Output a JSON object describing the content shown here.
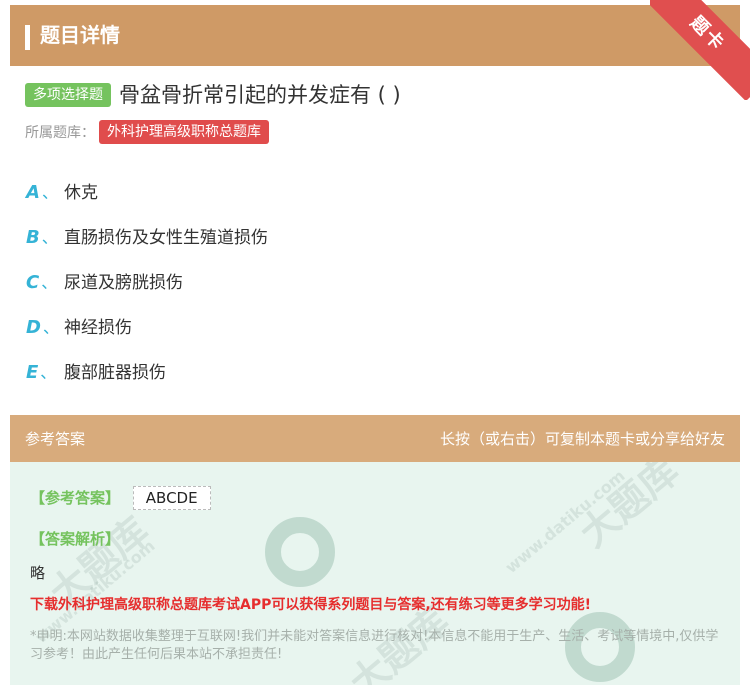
{
  "header": {
    "title": "题目详情",
    "corner_label": "题卡"
  },
  "question": {
    "type_badge": "多项选择题",
    "text": "骨盆骨折常引起的并发症有 ( )",
    "bank_label": "所属题库：",
    "bank_name": "外科护理高级职称总题库"
  },
  "options": [
    {
      "letter": "A",
      "sep": "、",
      "text": "休克"
    },
    {
      "letter": "B",
      "sep": "、",
      "text": "直肠损伤及女性生殖道损伤"
    },
    {
      "letter": "C",
      "sep": "、",
      "text": "尿道及膀胱损伤"
    },
    {
      "letter": "D",
      "sep": "、",
      "text": "神经损伤"
    },
    {
      "letter": "E",
      "sep": "、",
      "text": "腹部脏器损伤"
    }
  ],
  "answer_section": {
    "title": "参考答案",
    "hint": "长按（或右击）可复制本题卡或分享给好友",
    "answer_label": "【参考答案】",
    "answer_value": "ABCDE",
    "analysis_label": "【答案解析】",
    "analysis_text": "略",
    "promo": "下载外科护理高级职称总题库考试APP可以获得系列题目与答案,还有练习等更多学习功能!",
    "disclaimer": "*申明:本网站数据收集整理于互联网!我们并未能对答案信息进行核对!本信息不能用于生产、生活、考试等情境中,仅供学习参考！由此产生任何后果本站不承担责任!"
  },
  "colors": {
    "header": "#cf9a66",
    "answer_head": "#d8ab7c",
    "badge_green": "#75c35e",
    "tag_red": "#e04c4c",
    "option_letter": "#35b3d6",
    "promo_red": "#e62e2e"
  }
}
